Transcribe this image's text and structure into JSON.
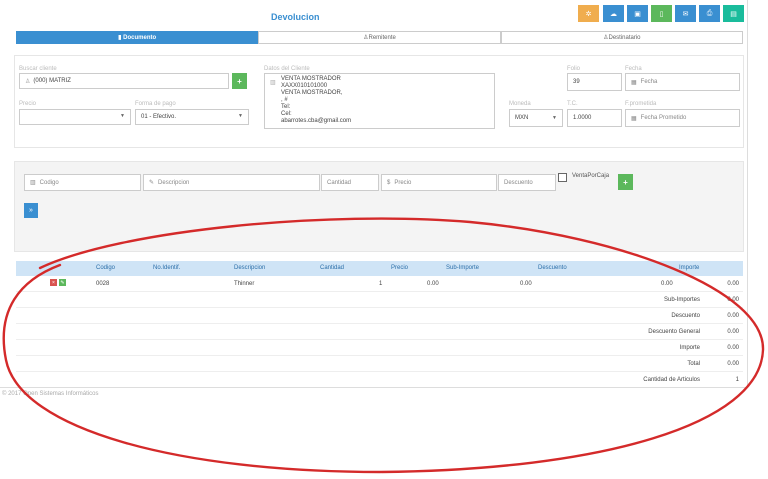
{
  "page": {
    "title": "Devolucion"
  },
  "toolbar": {
    "buttons": [
      {
        "icon": "cogs-icon",
        "glyph": "✲",
        "color": "#f0ad4e"
      },
      {
        "icon": "cloud-icon",
        "glyph": "☁",
        "color": "#3a8fd1"
      },
      {
        "icon": "money-icon",
        "glyph": "▣",
        "color": "#3a8fd1"
      },
      {
        "icon": "file-icon",
        "glyph": "▯",
        "color": "#5cb85c"
      },
      {
        "icon": "envelope-icon",
        "glyph": "✉",
        "color": "#3a8fd1"
      },
      {
        "icon": "print-icon",
        "glyph": "⎙",
        "color": "#3a8fd1"
      },
      {
        "icon": "save-icon",
        "glyph": "▤",
        "color": "#1abc9c"
      }
    ]
  },
  "tabs": [
    {
      "label": "Documento",
      "icon": "▮",
      "active": true
    },
    {
      "label": "Remitente",
      "icon": "♙",
      "active": false
    },
    {
      "label": "Destinatario",
      "icon": "♙",
      "active": false
    }
  ],
  "form": {
    "buscar_cliente_label": "Buscar cliente",
    "buscar_cliente_value": "(000) MATRIZ",
    "datos_cliente_label": "Datos del Cliente",
    "datos_cliente_lines": [
      "VENTA MOSTRADOR",
      "XAXX010101000",
      "VENTA MOSTRADOR,",
      ", #",
      "Tel:",
      "Cel:",
      "abarrotes.cba@gmail.com"
    ],
    "folio_label": "Folio",
    "folio_value": "39",
    "fecha_label": "Fecha",
    "fecha_value": "Fecha",
    "precio_label": "Precio",
    "precio_value": "",
    "forma_pago_label": "Forma de pago",
    "forma_pago_value": "01 - Efectivo.",
    "moneda_label": "Moneda",
    "moneda_value": "MXN",
    "tc_label": "T.C.",
    "tc_value": "1.0000",
    "fecha_prometida_label": "F.prometida",
    "fecha_prometida_value": "Fecha Prometido"
  },
  "item_entry": {
    "codigo_placeholder": "Codigo",
    "descripcion_placeholder": "Descripcion",
    "cantidad_placeholder": "Cantidad",
    "precio_placeholder": "Precio",
    "descuento_placeholder": "Descuento",
    "venta_por_caja_label": "VentaPorCaja",
    "add_glyph": "+",
    "next_glyph": "»"
  },
  "table": {
    "headers": [
      "Codigo",
      "No.Identif.",
      "Descripcion",
      "Cantidad",
      "Precio",
      "Sub-Importe",
      "Descuento",
      "Importe"
    ],
    "rows": [
      {
        "codigo": "0028",
        "no_identif": "",
        "descripcion": "Thinner",
        "cantidad": "1",
        "precio": "0.00",
        "sub_importe": "0.00",
        "descuento": "0.00",
        "importe": "0.00"
      }
    ],
    "summary": [
      {
        "label": "Sub-Importes",
        "value": "0.00"
      },
      {
        "label": "Descuento",
        "value": "0.00"
      },
      {
        "label": "Descuento General",
        "value": "0.00"
      },
      {
        "label": "Importe",
        "value": "0.00"
      },
      {
        "label": "Total",
        "value": "0.00"
      },
      {
        "label": "Cantidad de Articulos",
        "value": "1"
      }
    ]
  },
  "footer": {
    "text": "© 2017 Open Sistemas Informáticos"
  },
  "colors": {
    "accent": "#3a8fd1",
    "success": "#5cb85c",
    "annotation": "#d42a2a"
  }
}
